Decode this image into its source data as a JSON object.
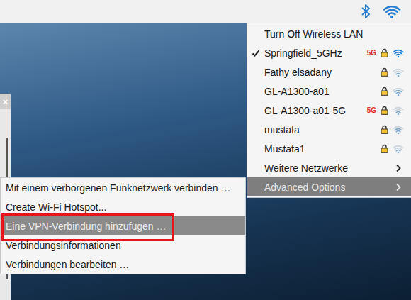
{
  "background_window": {
    "close_label": "×"
  },
  "wifi_menu": {
    "items": [
      {
        "kind": "action",
        "label": "Turn Off Wireless LAN",
        "selected": false
      },
      {
        "kind": "network",
        "label": "Springfield_5GHz",
        "connected": true,
        "secured": true,
        "badge": "5G",
        "signal": 1.0,
        "selected": false
      },
      {
        "kind": "network",
        "label": "Fathy elsadany",
        "connected": false,
        "secured": true,
        "signal": 0.34,
        "selected": false
      },
      {
        "kind": "network",
        "label": "GL-A1300-a01",
        "connected": false,
        "secured": true,
        "signal": 0.67,
        "selected": false
      },
      {
        "kind": "network",
        "label": "GL-A1300-a01-5G",
        "connected": false,
        "secured": true,
        "badge": "5G",
        "signal": 0.34,
        "selected": false
      },
      {
        "kind": "network",
        "label": "mustafa",
        "connected": false,
        "secured": true,
        "signal": 0.67,
        "selected": false
      },
      {
        "kind": "network",
        "label": "Mustafa1",
        "connected": false,
        "secured": true,
        "signal": 0.34,
        "selected": false
      },
      {
        "kind": "submenu",
        "label": "Weitere Netzwerke",
        "selected": false
      },
      {
        "kind": "submenu",
        "label": "Advanced Options",
        "selected": true
      }
    ]
  },
  "advanced_menu": {
    "items": [
      {
        "label": "Mit einem verborgenen Funknetzwerk verbinden …",
        "selected": false,
        "annotated": false
      },
      {
        "label": "Create Wi-Fi Hotspot...",
        "selected": false,
        "annotated": false
      },
      {
        "label": "Eine VPN-Verbindung hinzufügen …",
        "selected": true,
        "annotated": true
      },
      {
        "label": "Verbindungsinformationen",
        "selected": false,
        "annotated": false
      },
      {
        "label": "Verbindungen bearbeiten …",
        "selected": false,
        "annotated": false
      }
    ]
  }
}
